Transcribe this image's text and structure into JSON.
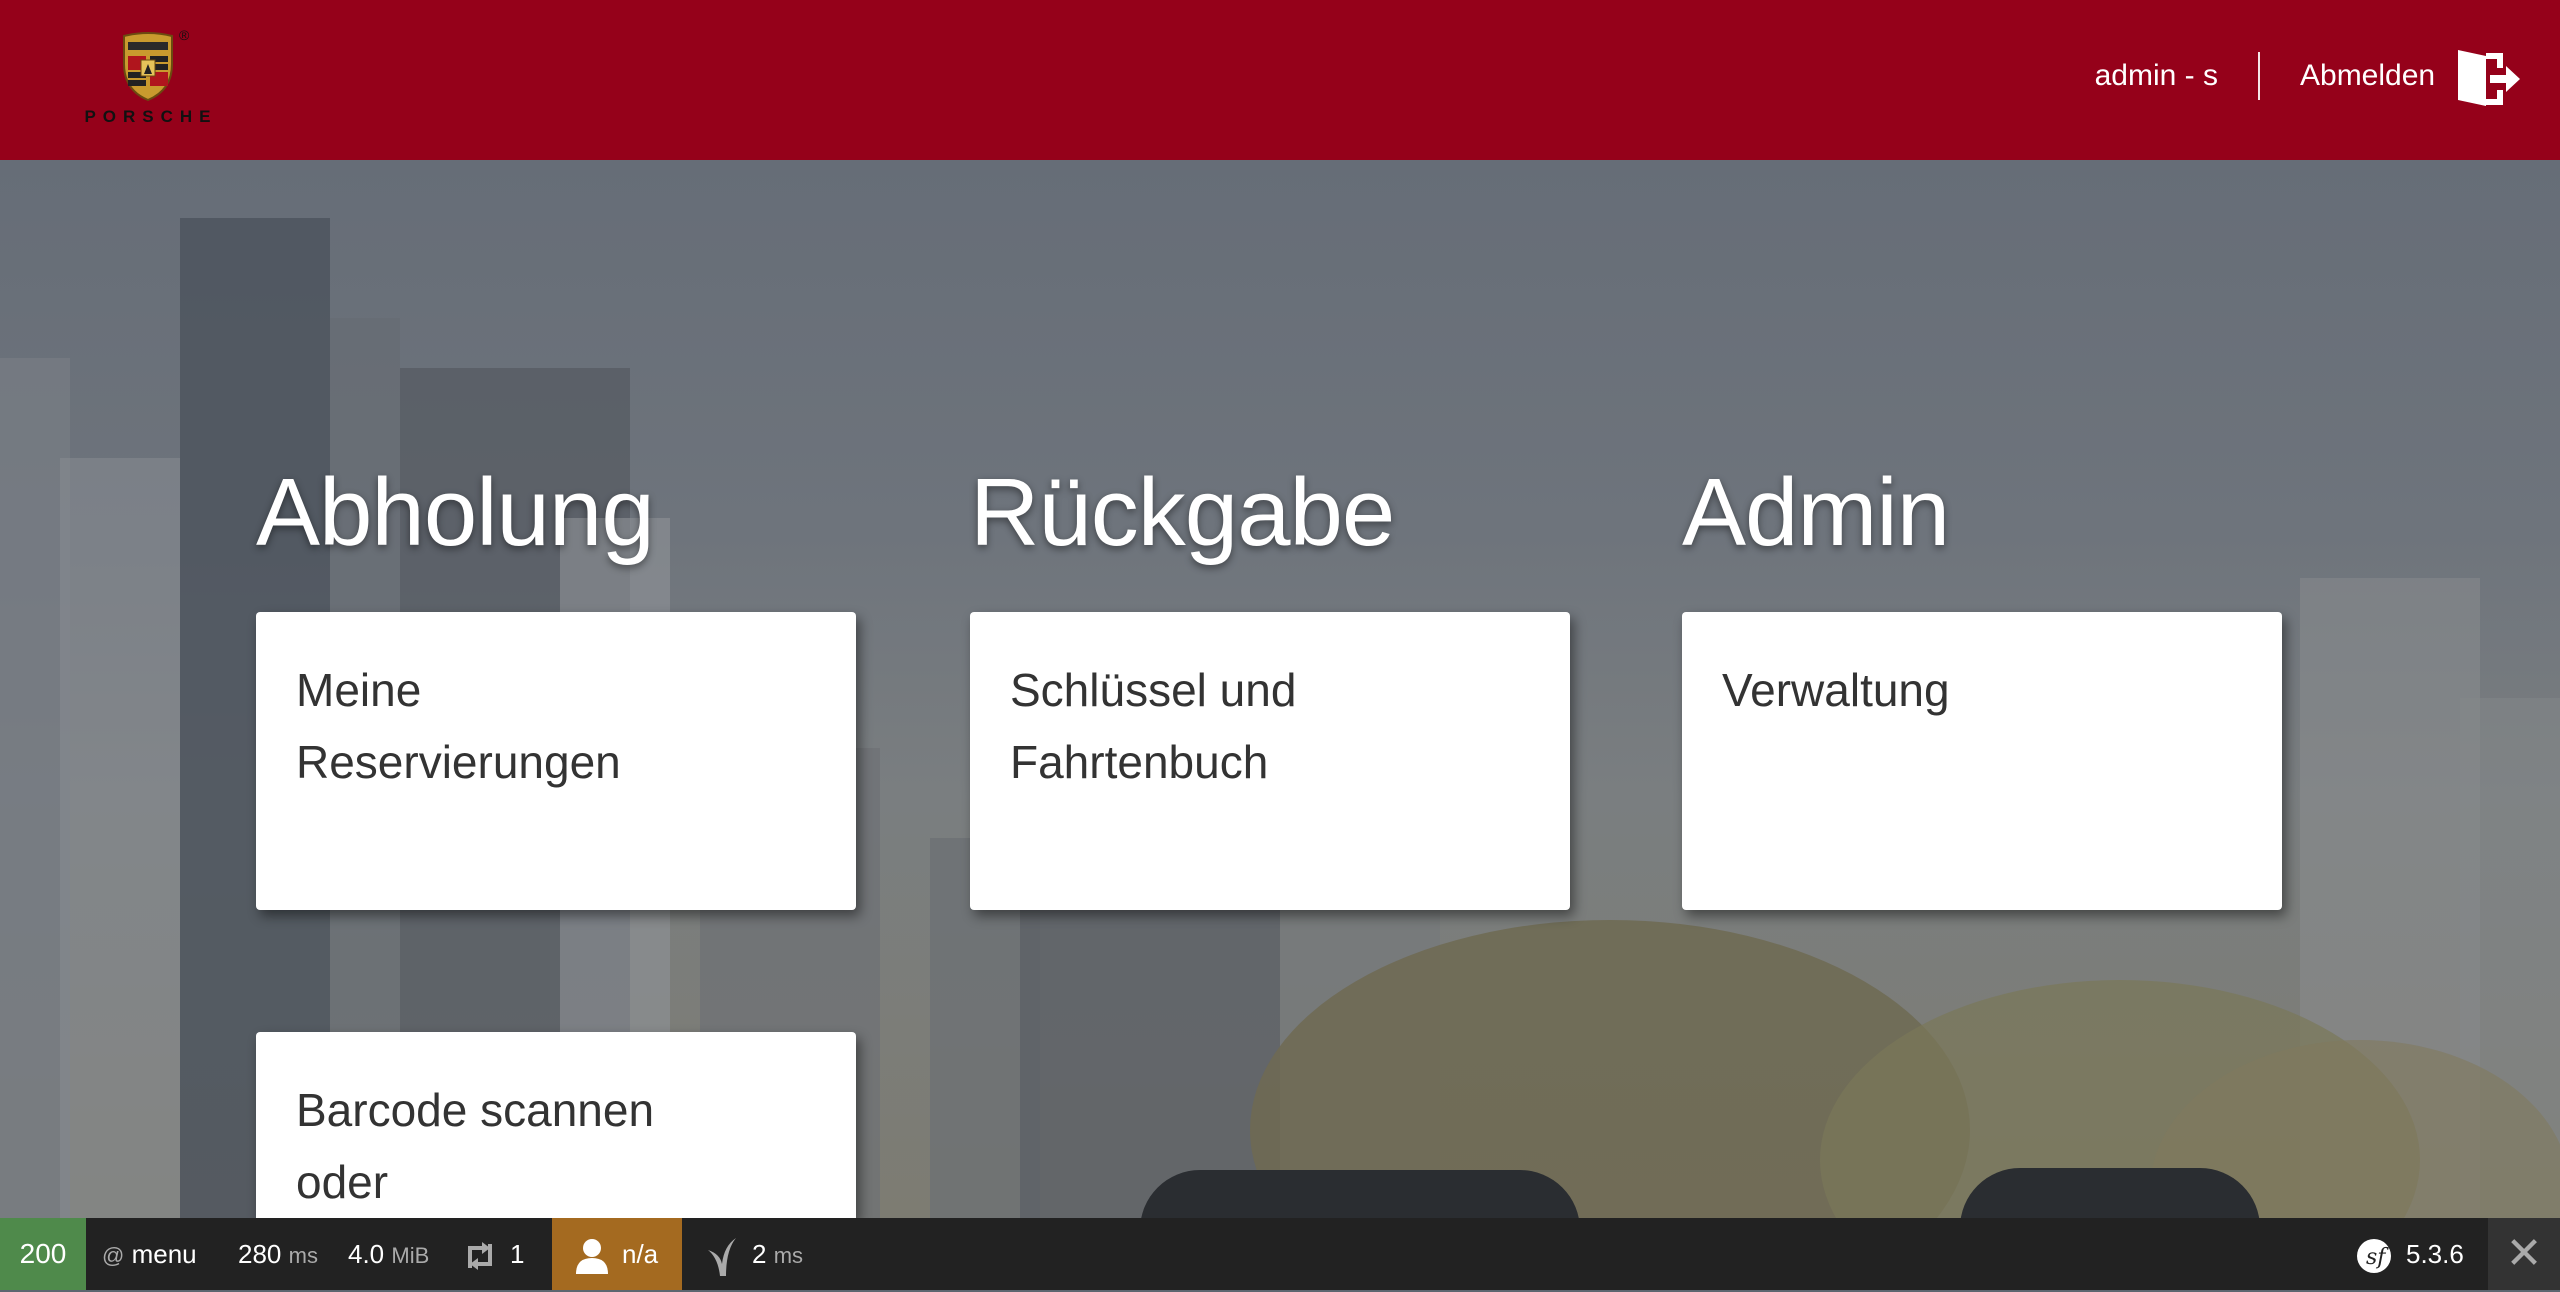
{
  "header": {
    "brand": "PORSCHE",
    "registered_mark": "®",
    "user": "admin - s",
    "logout_label": "Abmelden"
  },
  "sections": [
    {
      "title": "Abholung",
      "tiles": [
        {
          "label": "Meine Reservierungen"
        },
        {
          "label": "Barcode scannen oder"
        }
      ]
    },
    {
      "title": "Rückgabe",
      "tiles": [
        {
          "label": "Schlüssel und Fahrtenbuch"
        }
      ]
    },
    {
      "title": "Admin",
      "tiles": [
        {
          "label": "Verwaltung"
        }
      ]
    }
  ],
  "toolbar": {
    "status_code": "200",
    "route_prefix": "@",
    "route": "menu",
    "time_value": "280",
    "time_unit": "ms",
    "memory_value": "4.0",
    "memory_unit": "MiB",
    "requests_count": "1",
    "user": "n/a",
    "twig_value": "2",
    "twig_unit": "ms",
    "version": "5.3.6",
    "close_glyph": "✕"
  },
  "icons": {
    "logout": "logout-door-icon",
    "crest": "porsche-crest-icon",
    "requests": "ajax-requests-icon",
    "user": "user-icon",
    "twig": "twig-icon",
    "symfony": "symfony-logo-icon"
  },
  "colors": {
    "header": "#95011a",
    "toolbar": "#222222",
    "status_ok": "#4f8a4b",
    "user_badge": "#a46a20",
    "tile": "#ffffff",
    "tile_text": "#333333"
  }
}
